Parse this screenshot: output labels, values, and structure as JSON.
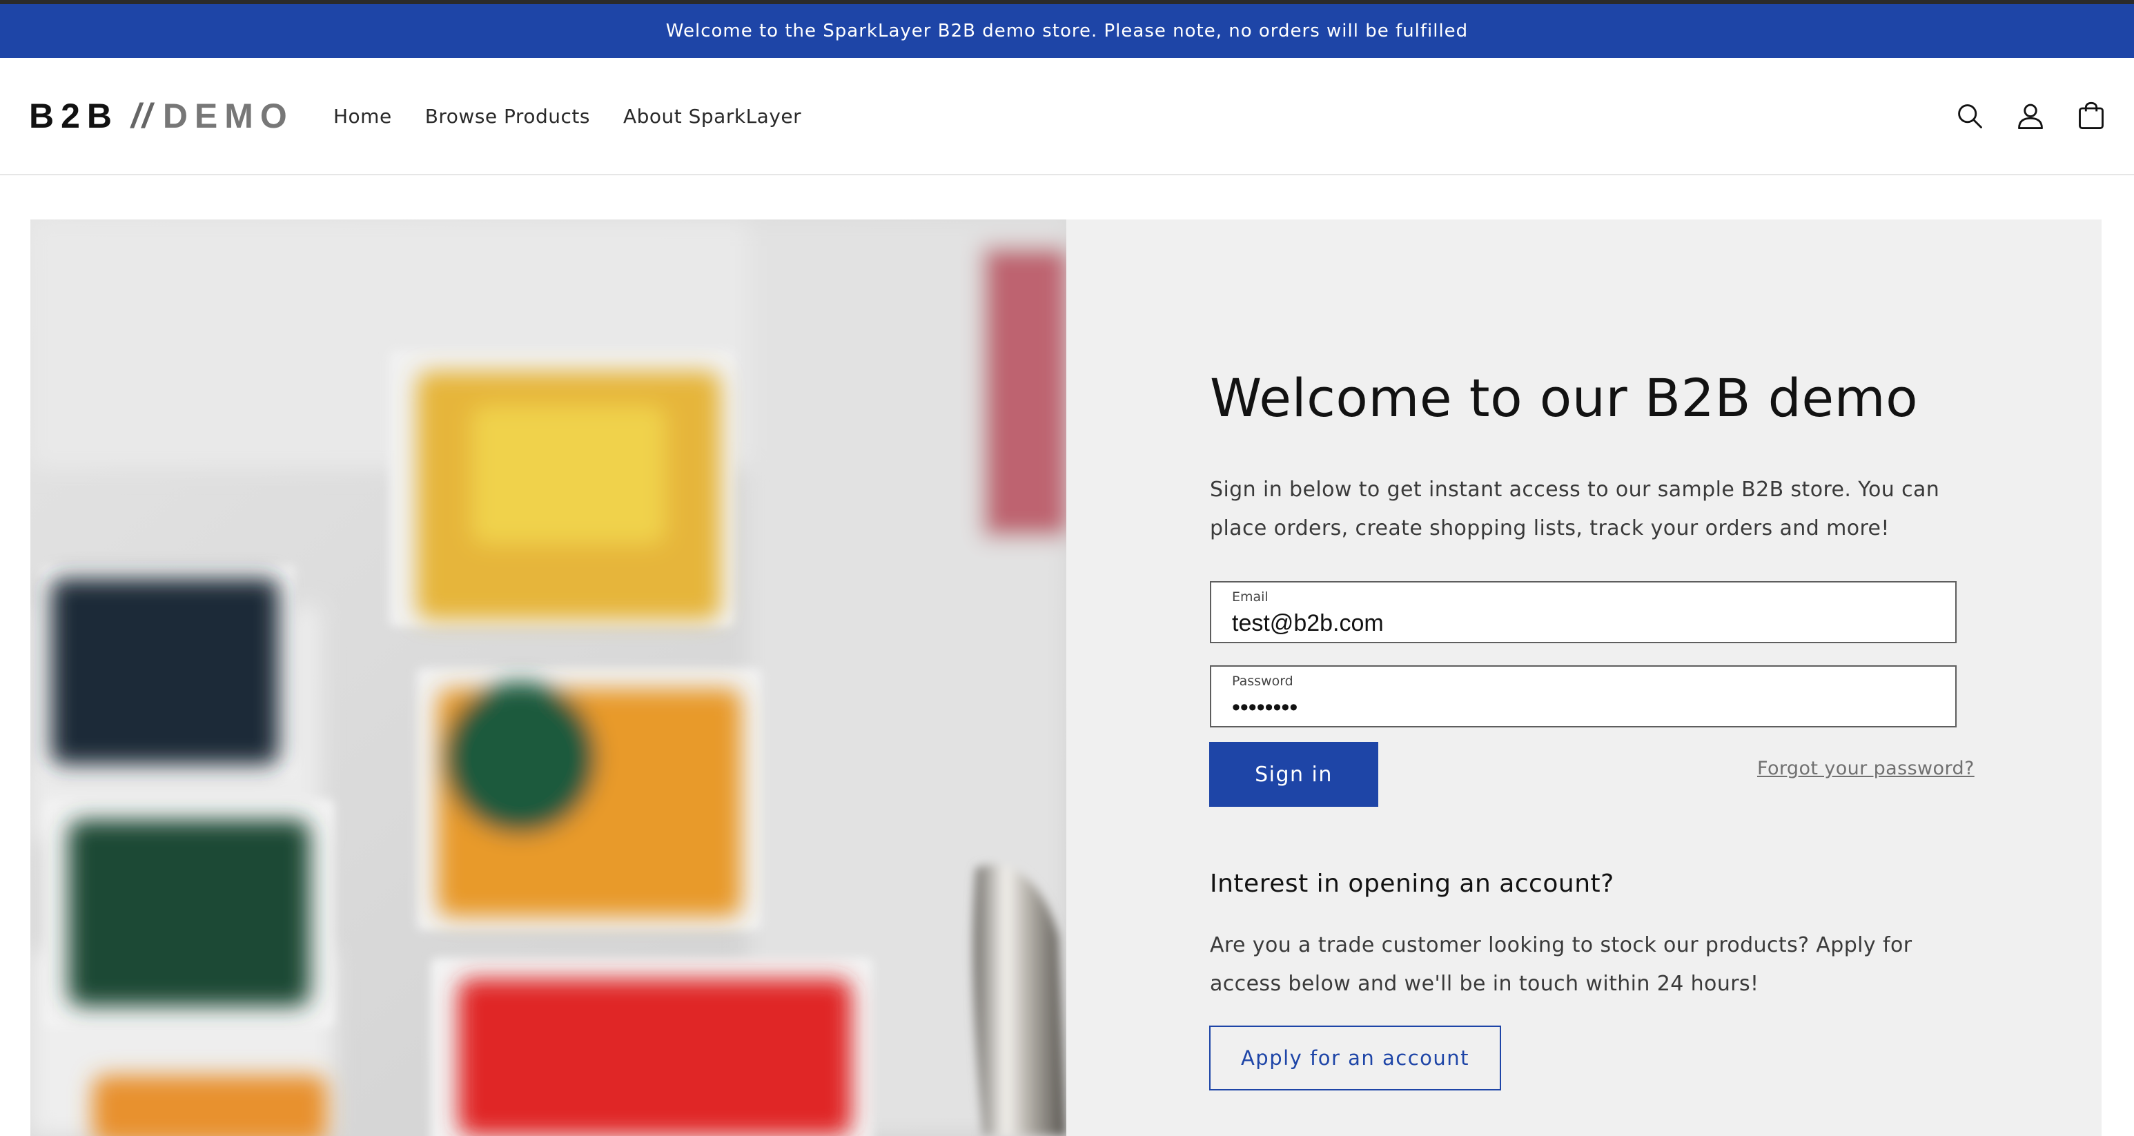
{
  "announcement": "Welcome to the SparkLayer B2B demo store. Please note, no orders will be fulfilled",
  "logo": {
    "primary": "B2B",
    "separator": "//",
    "secondary": "DEMO"
  },
  "nav": {
    "items": [
      {
        "label": "Home"
      },
      {
        "label": "Browse Products"
      },
      {
        "label": "About SparkLayer"
      }
    ]
  },
  "header_icons": [
    "search-icon",
    "account-icon",
    "cart-icon"
  ],
  "hero_image": {
    "subject": "blurred watercolor paint palette",
    "colors": [
      "#1f2a38",
      "#e6b53a",
      "#e89a2c",
      "#1d4a35",
      "#e02525",
      "#e8912f"
    ]
  },
  "login": {
    "title": "Welcome to our B2B demo",
    "intro": "Sign in below to get instant access to our sample B2B store. You can place orders, create shopping lists, track your orders and more!",
    "email_label": "Email",
    "email_value": "test@b2b.com",
    "password_label": "Password",
    "password_value": "••••••••",
    "signin_label": "Sign in",
    "forgot_label": "Forgot your password?"
  },
  "apply": {
    "title": "Interest in opening an account?",
    "text": "Are you a trade customer looking to stock our products? Apply for access below and we'll be in touch within 24 hours!",
    "button_label": "Apply for an account"
  },
  "colors": {
    "brand": "#1e45a7",
    "panel_bg": "#f0f0f0"
  }
}
